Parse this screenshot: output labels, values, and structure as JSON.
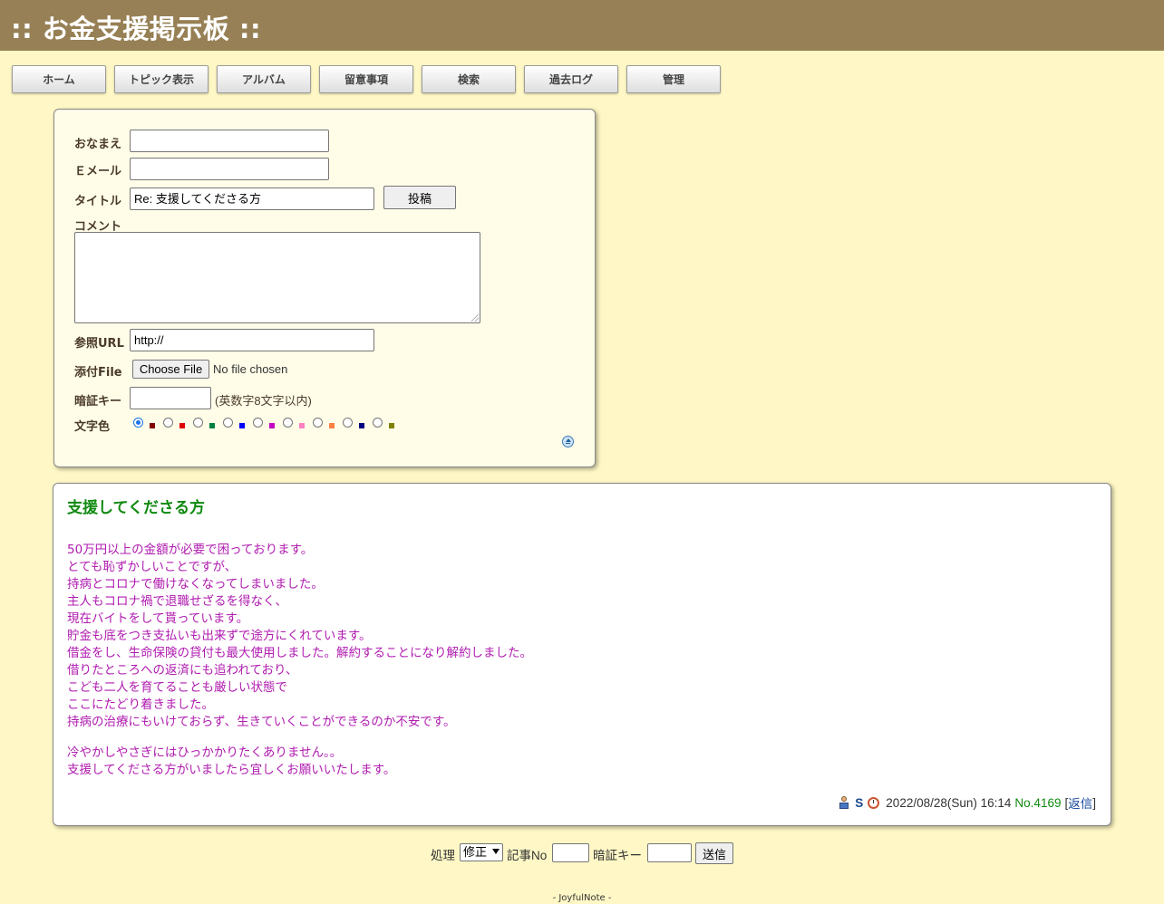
{
  "header": {
    "title": ":: お金支援掲示板 ::"
  },
  "nav": {
    "items": [
      {
        "label": "ホーム"
      },
      {
        "label": "トピック表示"
      },
      {
        "label": "アルバム"
      },
      {
        "label": "留意事項"
      },
      {
        "label": "検索"
      },
      {
        "label": "過去ログ"
      },
      {
        "label": "管理"
      }
    ]
  },
  "form": {
    "name_label": "おなまえ",
    "name_value": "",
    "email_label": "Ｅメール",
    "email_value": "",
    "title_label": "タイトル",
    "title_value": "Re: 支援してくださる方",
    "submit_label": "投稿",
    "comment_label": "コメント",
    "url_label": "参照URL",
    "url_value": "http://",
    "file_label": "添付File",
    "file_button": "Choose File",
    "file_status": "No file chosen",
    "key_label": "暗証キー",
    "key_hint": "(英数字8文字以内)",
    "color_label": "文字色",
    "colors": [
      "#800000",
      "#df0000",
      "#008040",
      "#0000ff",
      "#c100c1",
      "#ff80c0",
      "#ff8040",
      "#000080",
      "#808000"
    ],
    "selected_color_index": 0
  },
  "post": {
    "title": "支援してくださる方",
    "body_color": "#b01cb0",
    "lines": [
      "50万円以上の金額が必要で困っております。",
      "とても恥ずかしいことですが、",
      "持病とコロナで働けなくなってしまいました。",
      "主人もコロナ禍で退職せざるを得なく、",
      "現在バイトをして貰っています。",
      "貯金も底をつき支払いも出来ずで途方にくれています。",
      "借金をし、生命保険の貸付も最大使用しました。解約することになり解約しました。",
      "借りたところへの返済にも追われており、",
      "こども二人を育てることも厳しい状態で",
      "ここにたどり着きました。",
      "持病の治療にもいけておらず、生きていくことができるのか不安です。"
    ],
    "lines2": [
      "冷やかしやさぎにはひっかかりたくありません。。",
      "支援してくださる方がいましたら宜しくお願いいたします。"
    ],
    "author": "S",
    "datetime": "2022/08/28(Sun) 16:14",
    "number": "No.4169",
    "reply_open": "[",
    "reply_label": "返信",
    "reply_close": "]"
  },
  "proc": {
    "label": "処理",
    "selected": "修正",
    "no_label": "記事No",
    "key_label": "暗証キー",
    "send_label": "送信"
  },
  "footer": {
    "credit": "- JoyfulNote -"
  }
}
